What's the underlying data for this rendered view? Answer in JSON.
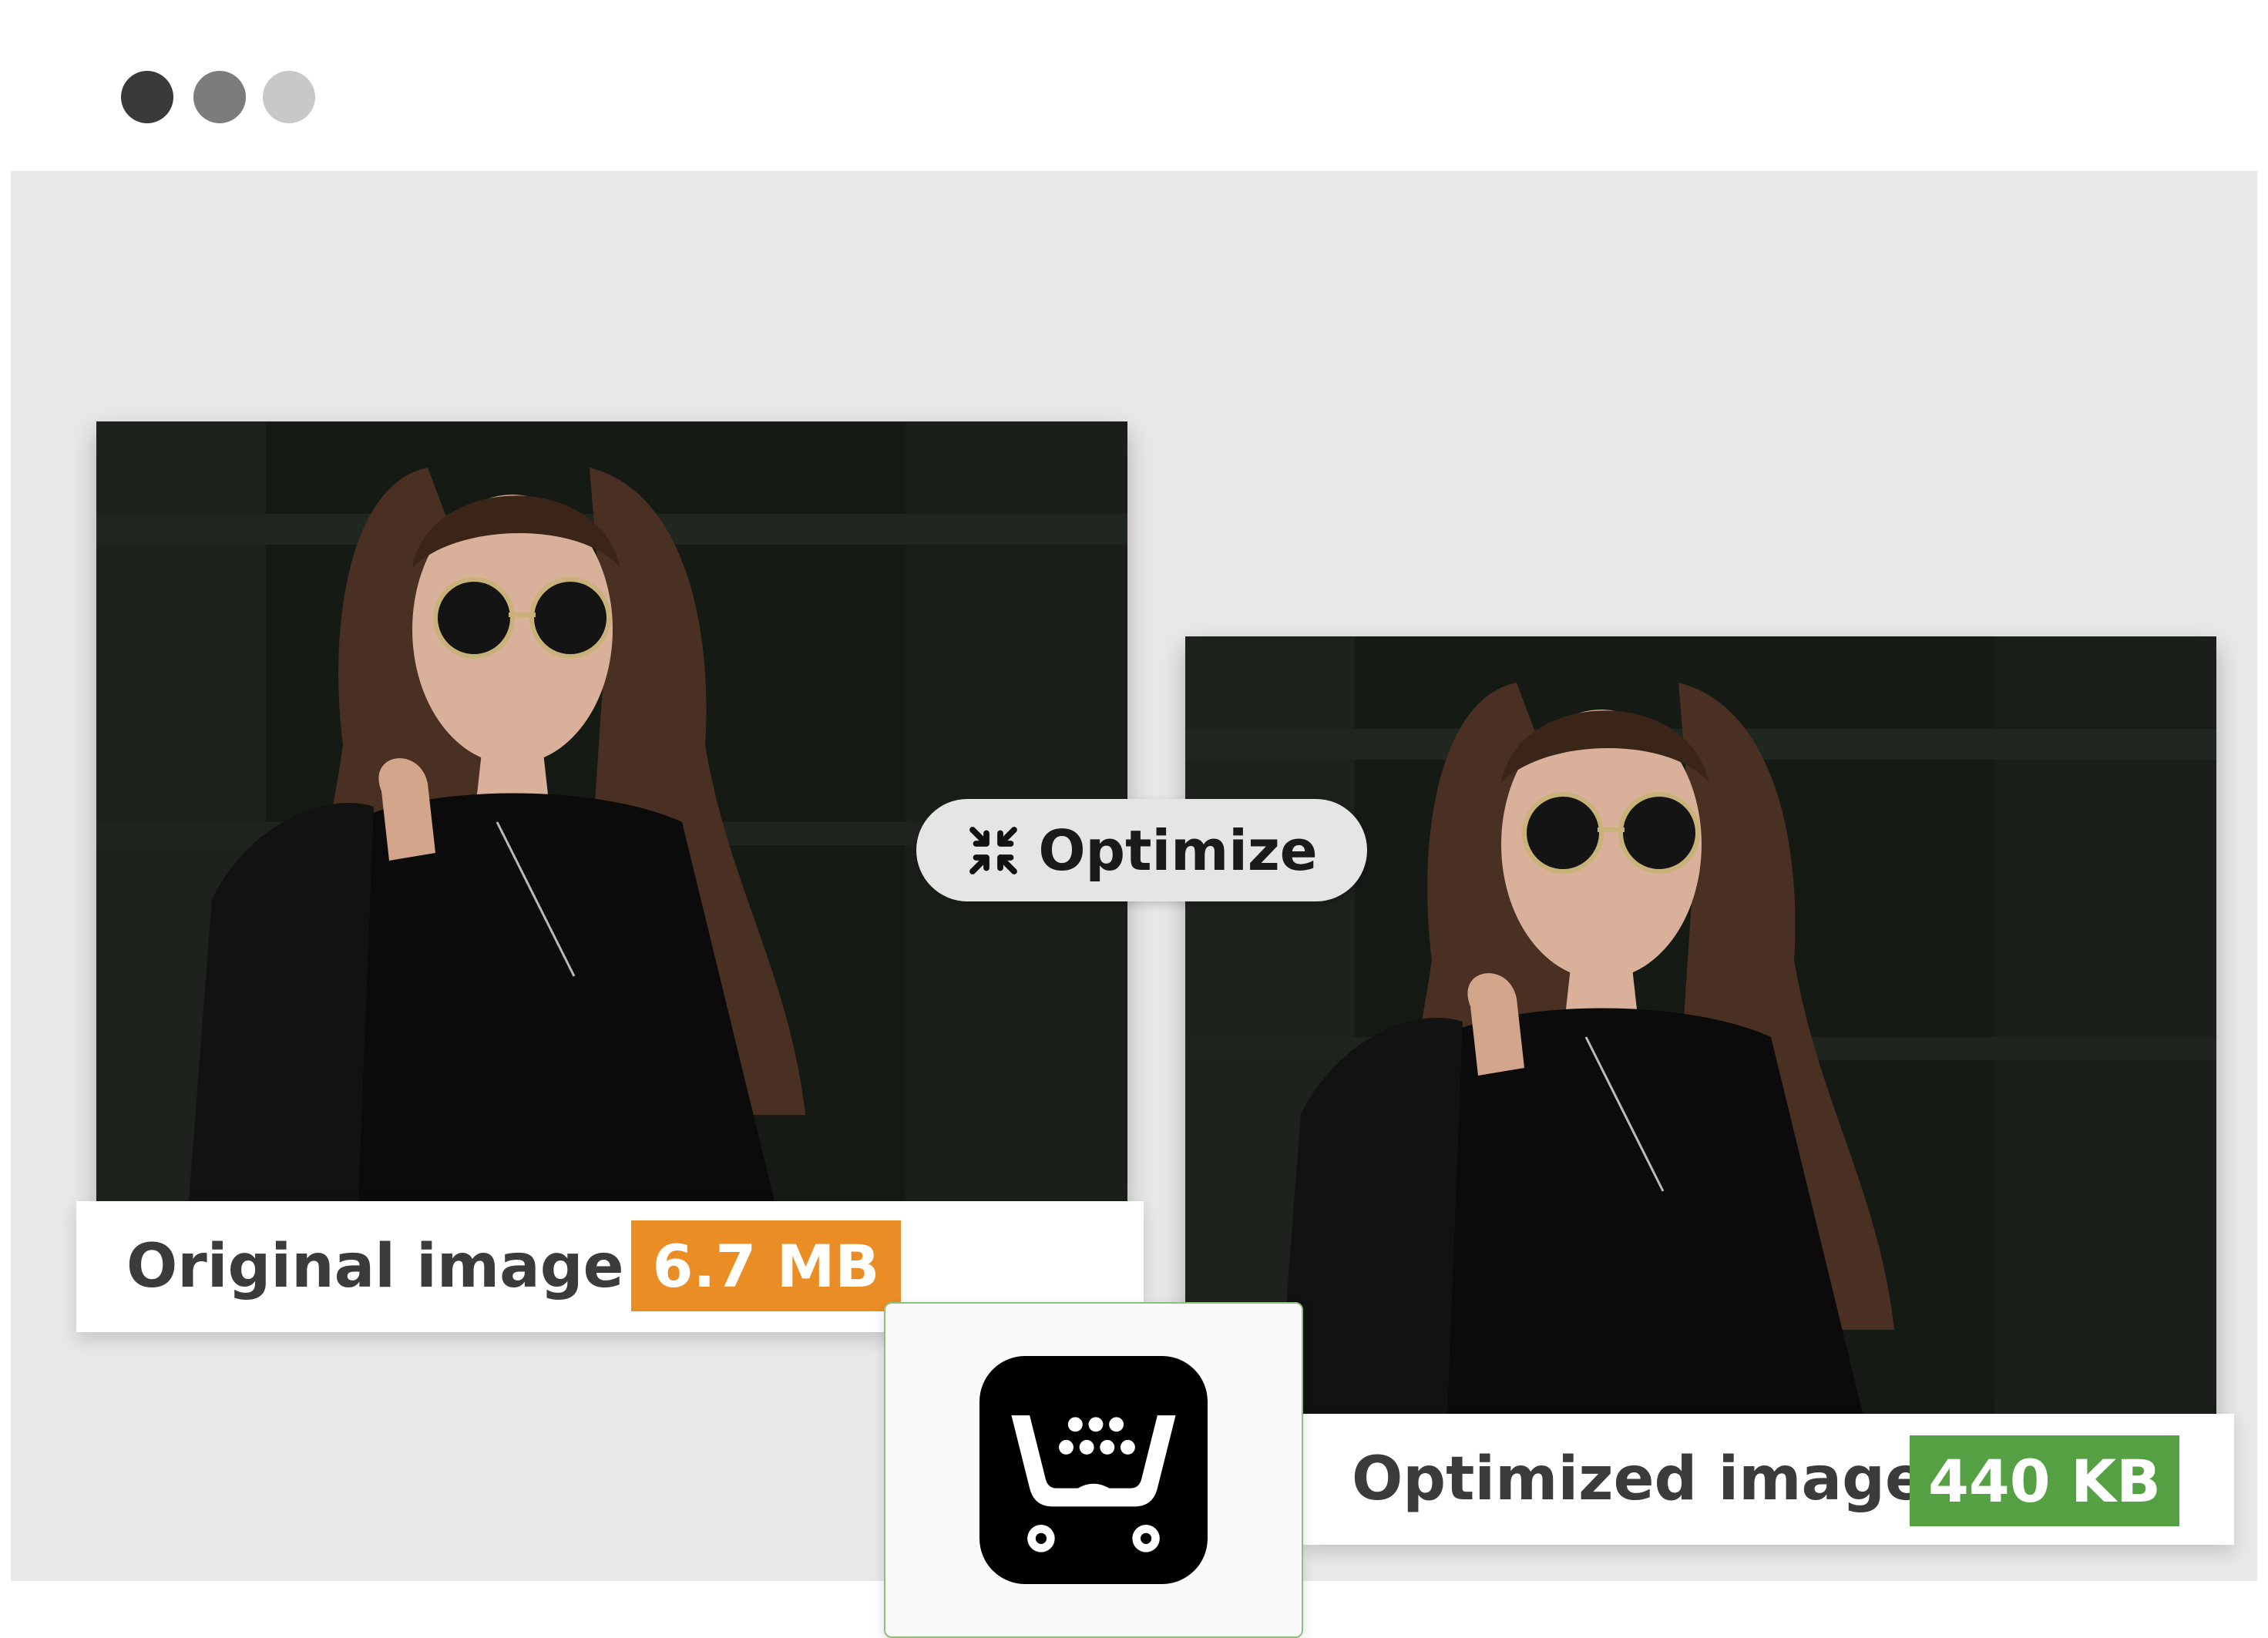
{
  "window": {
    "controls": [
      "dark-dot",
      "medium-dot",
      "light-dot"
    ]
  },
  "original": {
    "label": "Original image",
    "size": "6.7 MB",
    "badge_color": "#ea8d24"
  },
  "optimized": {
    "label": "Optimized image",
    "size": "440 KB",
    "badge_color": "#55a043"
  },
  "action": {
    "label": "Optimize",
    "icon": "compress-arrows-icon"
  },
  "logo": {
    "icon": "shopping-cart-logo-icon"
  }
}
